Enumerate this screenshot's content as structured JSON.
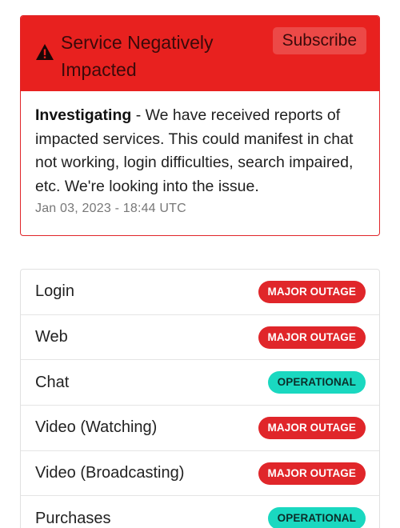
{
  "incident": {
    "title": "Service Negatively Impacted",
    "subscribe_label": "Subscribe",
    "status_label": "Investigating",
    "message": " - We have received reports of impacted services.  This could manifest in chat not working, login difficulties, search impaired, etc.  We're looking into the issue.",
    "timestamp": "Jan 03, 2023 - 18:44 UTC",
    "icon": "warning-icon"
  },
  "components": [
    {
      "name": "Login",
      "status": "MAJOR OUTAGE",
      "type": "outage"
    },
    {
      "name": "Web",
      "status": "MAJOR OUTAGE",
      "type": "outage"
    },
    {
      "name": "Chat",
      "status": "OPERATIONAL",
      "type": "operational"
    },
    {
      "name": "Video (Watching)",
      "status": "MAJOR OUTAGE",
      "type": "outage"
    },
    {
      "name": "Video (Broadcasting)",
      "status": "MAJOR OUTAGE",
      "type": "outage"
    },
    {
      "name": "Purchases",
      "status": "OPERATIONAL",
      "type": "operational"
    }
  ],
  "colors": {
    "outage": "#e0262a",
    "operational": "#1ad8c0",
    "header": "#e8211f"
  }
}
